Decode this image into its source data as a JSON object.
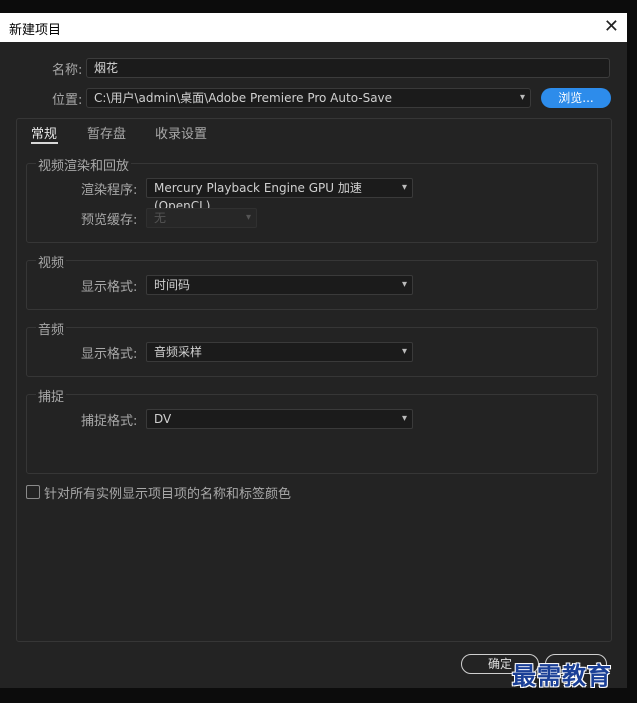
{
  "window": {
    "title": "新建项目"
  },
  "form": {
    "name_label": "名称:",
    "name_value": "烟花",
    "location_label": "位置:",
    "location_value": "C:\\用户\\admin\\桌面\\Adobe Premiere Pro Auto-Save",
    "browse_label": "浏览..."
  },
  "tabs": [
    {
      "label": "常规",
      "active": true
    },
    {
      "label": "暂存盘",
      "active": false
    },
    {
      "label": "收录设置",
      "active": false
    }
  ],
  "video_render": {
    "title": "视频渲染和回放",
    "renderer_label": "渲染程序:",
    "renderer_value": "Mercury Playback Engine GPU 加速 (OpenCL)",
    "preview_cache_label": "预览缓存:",
    "preview_cache_value": "无"
  },
  "video": {
    "title": "视频",
    "display_format_label": "显示格式:",
    "display_format_value": "时间码"
  },
  "audio": {
    "title": "音频",
    "display_format_label": "显示格式:",
    "display_format_value": "音频采样"
  },
  "capture": {
    "title": "捕捉",
    "capture_format_label": "捕捉格式:",
    "capture_format_value": "DV"
  },
  "checkbox": {
    "label": "针对所有实例显示项目项的名称和标签颜色",
    "checked": false
  },
  "buttons": {
    "ok": "确定"
  },
  "watermark": "最需教育",
  "colors": {
    "accent": "#2d8ceb",
    "background": "#232323",
    "watermark": "#1a3f96"
  },
  "icons": {
    "close": "close-icon",
    "dropdown": "chevron-down-icon"
  }
}
